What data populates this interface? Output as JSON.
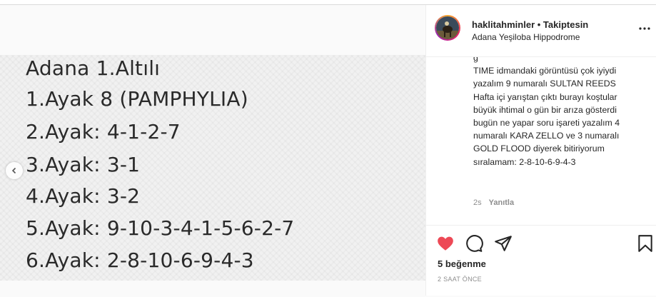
{
  "post": {
    "note_lines": [
      "Adana 1.Altılı",
      "1.Ayak 8  (PAMPHYLIA)",
      "2.Ayak: 4-1-2-7",
      "3.Ayak: 3-1",
      "4.Ayak: 3-2",
      "5.Ayak: 9-10-3-4-1-5-6-2-7",
      "6.Ayak: 2-8-10-6-9-4-3"
    ]
  },
  "header": {
    "username": "haklitahminler",
    "separator": " • ",
    "follow_status": "Takiptesin",
    "location": "Adana Yeşiloba Hippodrome"
  },
  "comment": {
    "text": "g\nTIME idmandaki görüntüsü çok iyiydi yazalım 9 numaralı SULTAN REEDS Hafta içi yarıştan çıktı burayı koştular büyük ihtimal o gün bir arıza gösterdi bugün ne yapar soru işareti yazalım 4 numaralı KARA ZELLO ve 3 numaralı GOLD FLOOD diyerek bitiriyorum sıralamam: 2-8-10-6-9-4-3",
    "age": "2s",
    "reply_label": "Yanıtla"
  },
  "footer": {
    "likes": "5 beğenme",
    "timestamp": "2 SAAT ÖNCE"
  },
  "icons": {
    "like": "heart-icon",
    "comment": "comment-icon",
    "share": "share-icon",
    "save": "bookmark-icon",
    "more": "more-icon",
    "prev": "chevron-left-icon"
  },
  "colors": {
    "like_active": "#ed4956",
    "text": "#262626",
    "muted": "#8e8e8e"
  }
}
